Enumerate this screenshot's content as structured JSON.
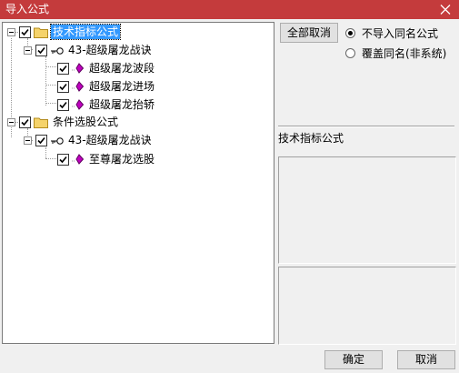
{
  "window": {
    "title": "导入公式"
  },
  "tree": {
    "nodes": [
      {
        "label": "技术指标公式",
        "level": 0
      },
      {
        "label": "43-超级屠龙战诀",
        "level": 1
      },
      {
        "label": "超级屠龙波段",
        "level": 2
      },
      {
        "label": "超级屠龙进场",
        "level": 2
      },
      {
        "label": "超级屠龙抬轿",
        "level": 2
      },
      {
        "label": "条件选股公式",
        "level": 0
      },
      {
        "label": "43-超级屠龙战诀",
        "level": 1
      },
      {
        "label": "至尊屠龙选股",
        "level": 2
      }
    ]
  },
  "actions": {
    "deselect_all": "全部取消",
    "ok": "确定",
    "cancel": "取消"
  },
  "options": {
    "no_import_same_name": "不导入同名公式",
    "overwrite_same_name": "覆盖同名(非系统)"
  },
  "info": {
    "formula_type": "技术指标公式"
  },
  "colors": {
    "titlebar": "#c43b3c",
    "formula_icon": "#c000c0",
    "folder": "#f5d36b",
    "selection": "#3399ff"
  }
}
